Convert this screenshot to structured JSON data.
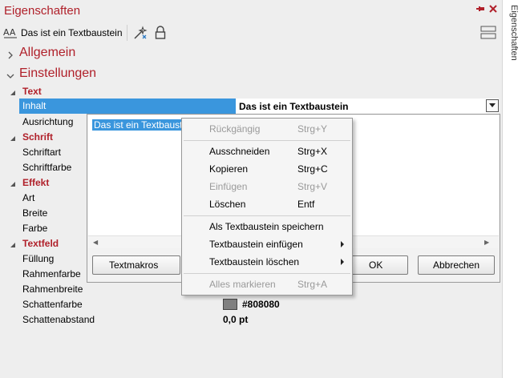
{
  "panel": {
    "title": "Eigenschaften",
    "side_tab_label": "Eigenschaften"
  },
  "toolbar": {
    "label": "Das ist ein Textbaustein"
  },
  "sections": {
    "allgemein": "Allgemein",
    "einstellungen": "Einstellungen"
  },
  "categories": {
    "text": "Text",
    "schrift": "Schrift",
    "effekt": "Effekt",
    "textfeld": "Textfeld"
  },
  "properties": {
    "inhalt": {
      "name": "Inhalt",
      "value": "Das ist ein Textbaustein"
    },
    "ausrichtung": {
      "name": "Ausrichtung"
    },
    "schriftart": {
      "name": "Schriftart"
    },
    "schriftfarbe": {
      "name": "Schriftfarbe"
    },
    "art": {
      "name": "Art"
    },
    "breite": {
      "name": "Breite"
    },
    "farbe": {
      "name": "Farbe"
    },
    "fuellung": {
      "name": "Füllung"
    },
    "rahmenfarbe": {
      "name": "Rahmenfarbe"
    },
    "rahmenbreite": {
      "name": "Rahmenbreite"
    },
    "schattenfarbe": {
      "name": "Schattenfarbe",
      "value": "#808080"
    },
    "schattenabstand": {
      "name": "Schattenabstand",
      "value": "0,0 pt"
    }
  },
  "editor": {
    "text": "Das ist ein Textbaustein",
    "textmakros_label": "Textmakros",
    "ok_label": "OK",
    "cancel_label": "Abbrechen"
  },
  "context_menu": {
    "undo": {
      "label": "Rückgängig",
      "shortcut": "Strg+Y"
    },
    "cut": {
      "label": "Ausschneiden",
      "shortcut": "Strg+X"
    },
    "copy": {
      "label": "Kopieren",
      "shortcut": "Strg+C"
    },
    "paste": {
      "label": "Einfügen",
      "shortcut": "Strg+V"
    },
    "delete": {
      "label": "Löschen",
      "shortcut": "Entf"
    },
    "save_block": {
      "label": "Als Textbaustein speichern"
    },
    "insert_block": {
      "label": "Textbaustein einfügen"
    },
    "delete_block": {
      "label": "Textbaustein löschen"
    },
    "select_all": {
      "label": "Alles markieren",
      "shortcut": "Strg+A"
    }
  },
  "colors": {
    "accent": "#b0202a",
    "selection": "#3a96dd",
    "shadow_color": "#808080"
  }
}
